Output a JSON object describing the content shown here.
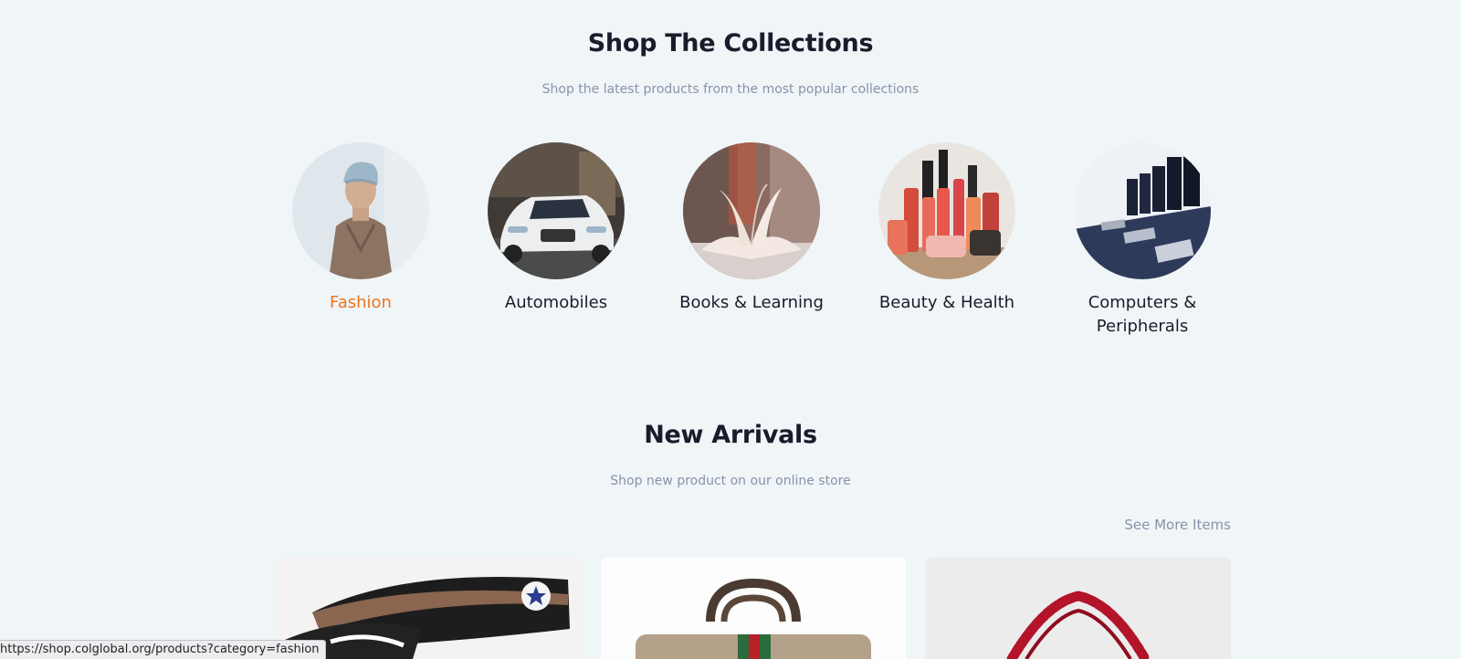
{
  "collections": {
    "title": "Shop The Collections",
    "subtitle": "Shop the latest products from the most popular collections",
    "items": [
      {
        "label": "Fashion",
        "active": true
      },
      {
        "label": "Automobiles"
      },
      {
        "label": "Books & Learning"
      },
      {
        "label": "Beauty & Health"
      },
      {
        "label": "Computers & Peripherals"
      }
    ]
  },
  "arrivals": {
    "title": "New Arrivals",
    "subtitle": "Shop new product on our online store",
    "see_more": "See More Items"
  },
  "status_bar": {
    "url": "https://shop.colglobal.org/products?category=fashion"
  },
  "colors": {
    "background": "#f0f5f8",
    "accent": "#f2721c",
    "heading": "#1b1b2b",
    "muted": "#8a93a8"
  }
}
